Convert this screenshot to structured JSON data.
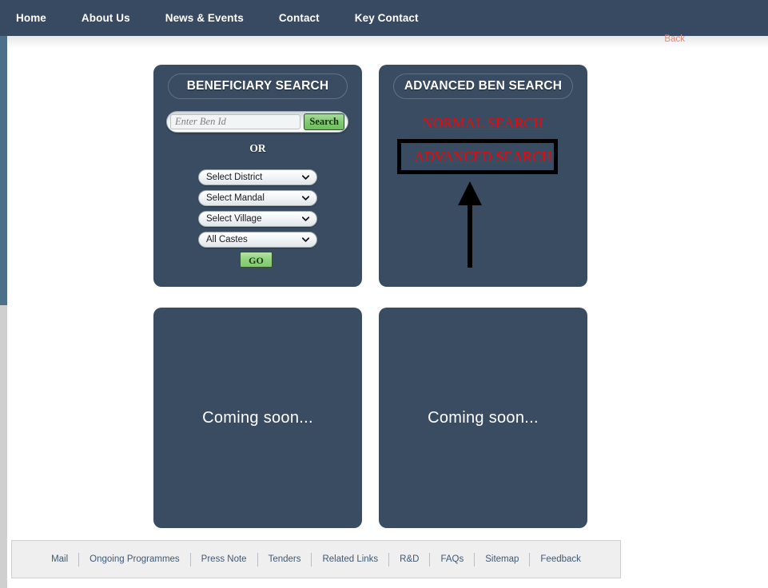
{
  "nav": {
    "items": [
      {
        "label": "Home"
      },
      {
        "label": "About Us"
      },
      {
        "label": "News & Events"
      },
      {
        "label": "Contact"
      },
      {
        "label": "Key Contact"
      }
    ]
  },
  "back_link": {
    "label": "Back"
  },
  "panels": {
    "beneficiary_search": {
      "title": "BENEFICIARY SEARCH",
      "search": {
        "placeholder": "Enter Ben Id",
        "value": "",
        "button_label": "Search"
      },
      "or_label": "OR",
      "selects": [
        {
          "name": "district",
          "selected": "Select District"
        },
        {
          "name": "mandal",
          "selected": "Select Mandal"
        },
        {
          "name": "village",
          "selected": "Select Village"
        },
        {
          "name": "caste",
          "selected": "All Castes"
        }
      ],
      "go_label": "GO"
    },
    "advanced_ben_search": {
      "title": "ADVANCED BEN SEARCH",
      "links": [
        {
          "name": "normal-search",
          "label": "NORMAL SEARCH"
        },
        {
          "name": "advanced-search",
          "label": "ADVANCED SEARCH"
        }
      ]
    },
    "coming_soon_left": {
      "text": "Coming soon..."
    },
    "coming_soon_right": {
      "text": "Coming soon..."
    }
  },
  "footer": {
    "links": [
      {
        "label": "Mail"
      },
      {
        "label": "Ongoing Programmes"
      },
      {
        "label": "Press Note"
      },
      {
        "label": "Tenders"
      },
      {
        "label": "Related Links"
      },
      {
        "label": "R&D"
      },
      {
        "label": "FAQs"
      },
      {
        "label": "Sitemap"
      },
      {
        "label": "Feedback"
      }
    ]
  },
  "colors": {
    "nav_background": "#374a61",
    "panel_background": "#3a4c61",
    "link_red": "#ff0000",
    "back_salmon": "#e08a78",
    "button_green": "#7fc96f",
    "footer_background": "#efefef",
    "annotation_black": "#000000",
    "scrollbar_thumb": "#4c7089"
  }
}
